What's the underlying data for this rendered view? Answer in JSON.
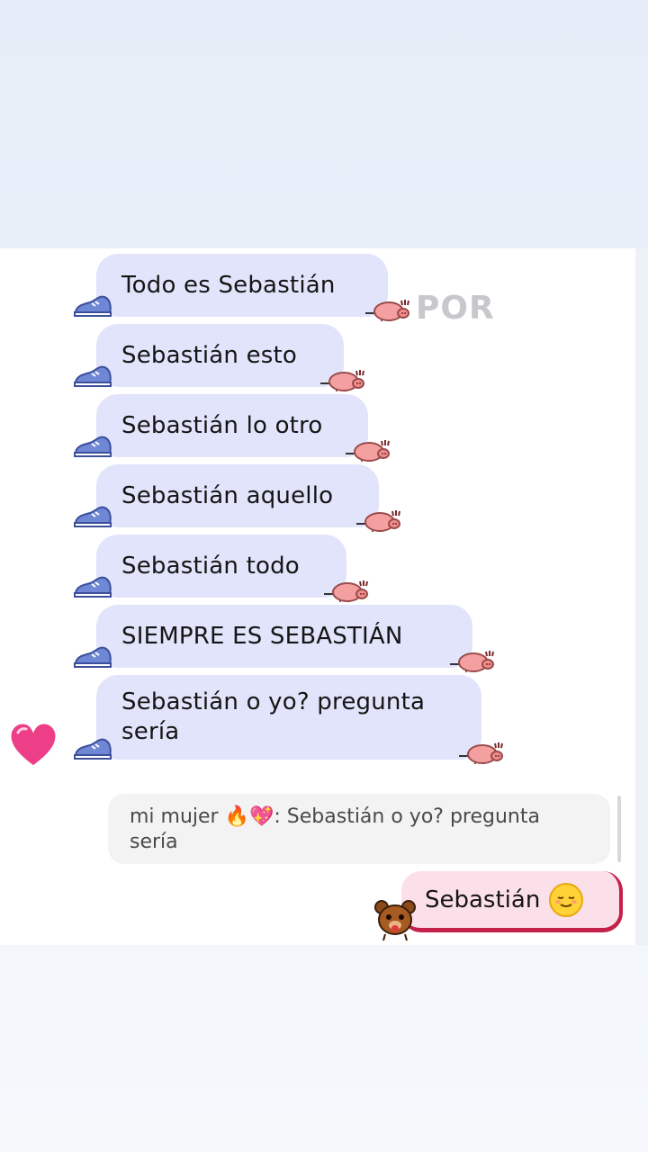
{
  "messages": [
    {
      "text": "Todo es Sebastián"
    },
    {
      "text": "Sebastián esto"
    },
    {
      "text": "Sebastián lo otro"
    },
    {
      "text": "Sebastián aquello"
    },
    {
      "text": "Sebastián todo"
    },
    {
      "text": "SIEMPRE ES SEBASTIÁN"
    },
    {
      "text_line1": "Sebastián o yo? pregunta",
      "text_line2": "sería"
    }
  ],
  "watermark": "POR",
  "quoted": {
    "line1": "mi mujer 🔥💖: Sebastián o yo? pregunta",
    "line2": "sería"
  },
  "reply": {
    "text": "Sebastián"
  },
  "icons": {
    "sticker_left": "shoe-icon",
    "sticker_right": "pig-icon",
    "reaction": "heart-icon",
    "reply_sticker": "bear-icon",
    "reply_emoji": "relieved-face-icon"
  },
  "colors": {
    "incoming_bubble": "#e1e4fb",
    "outgoing_bubble": "#fbdfe9",
    "outgoing_accent": "#c4204a",
    "quote_bg": "#f3f3f3"
  }
}
